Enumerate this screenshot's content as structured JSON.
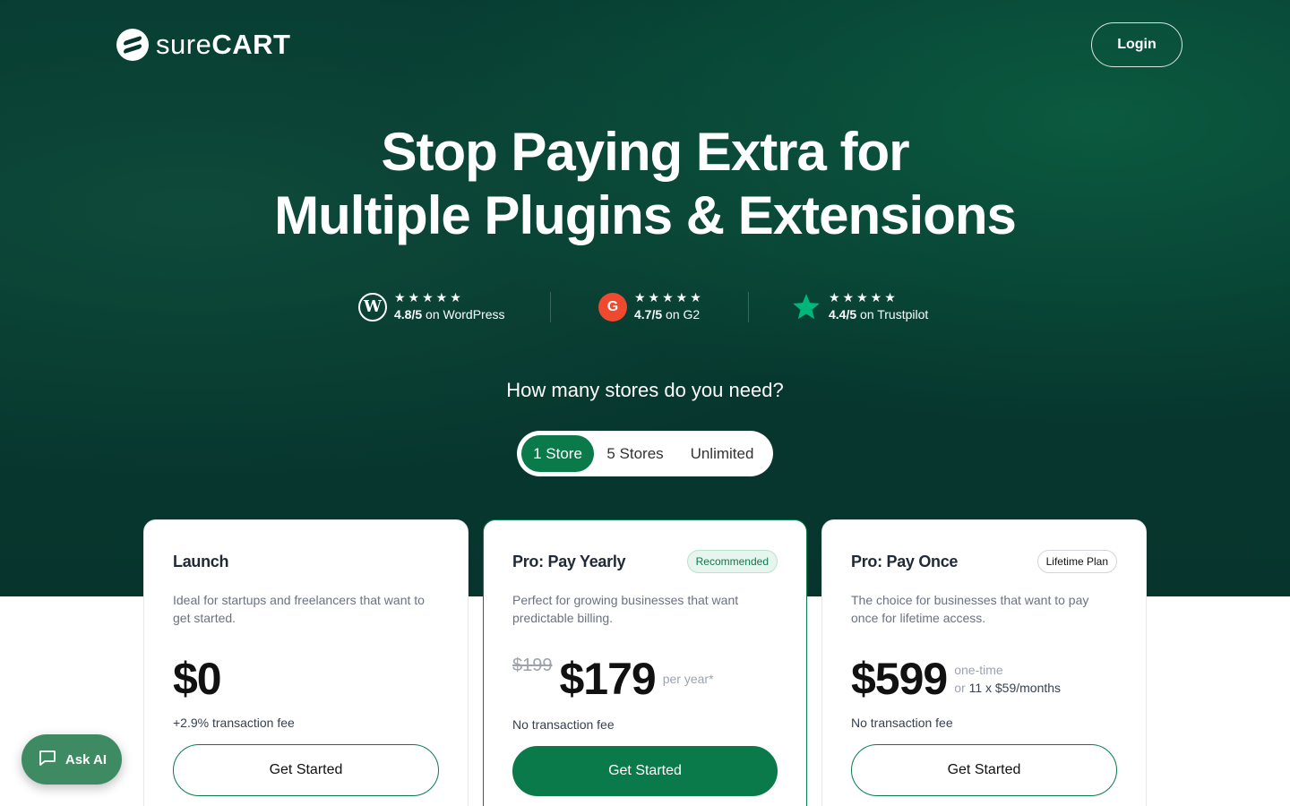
{
  "brand": {
    "name_light": "sure",
    "name_bold": "CART"
  },
  "header": {
    "login_label": "Login"
  },
  "hero": {
    "headline_line1": "Stop Paying Extra for",
    "headline_line2": "Multiple Plugins & Extensions"
  },
  "ratings": [
    {
      "stars": "★★★★★",
      "score": "4.8/5",
      "source": " on WordPress",
      "icon": "wordpress-icon",
      "icon_glyph": "W"
    },
    {
      "stars": "★★★★★",
      "score": "4.7/5",
      "source": " on G2",
      "icon": "g2-icon",
      "icon_glyph": "G"
    },
    {
      "stars": "★★★★★",
      "score": "4.4/5",
      "source": " on Trustpilot",
      "icon": "trustpilot-star-icon"
    }
  ],
  "store_selector": {
    "question": "How many stores do you need?",
    "options": [
      "1 Store",
      "5 Stores",
      "Unlimited"
    ],
    "selected": "1 Store"
  },
  "plans": [
    {
      "title": "Launch",
      "description": "Ideal for startups and freelancers that want to get started.",
      "price": "$0",
      "fee": "+2.9% transaction fee",
      "cta": "Get Started"
    },
    {
      "title": "Pro: Pay Yearly",
      "badge": "Recommended",
      "description": "Perfect for growing businesses that want predictable billing.",
      "old_price": "$199",
      "price": "$179",
      "period": "per year*",
      "fee": "No transaction fee",
      "cta": "Get Started"
    },
    {
      "title": "Pro: Pay Once",
      "badge": "Lifetime Plan",
      "description": "The choice for businesses that want to pay once for lifetime access.",
      "price": "$599",
      "period": "one-time",
      "installment_prefix": "or ",
      "installment": "11 x $59/months",
      "fee": "No transaction fee",
      "cta": "Get Started"
    }
  ],
  "assistant": {
    "label": "Ask AI",
    "icon": "chat-bubble-icon"
  },
  "colors": {
    "hero_bg": "#07352d",
    "accent": "#0b7a4b",
    "g2_red": "#ef4a30",
    "trustpilot_green": "#00b67a"
  }
}
